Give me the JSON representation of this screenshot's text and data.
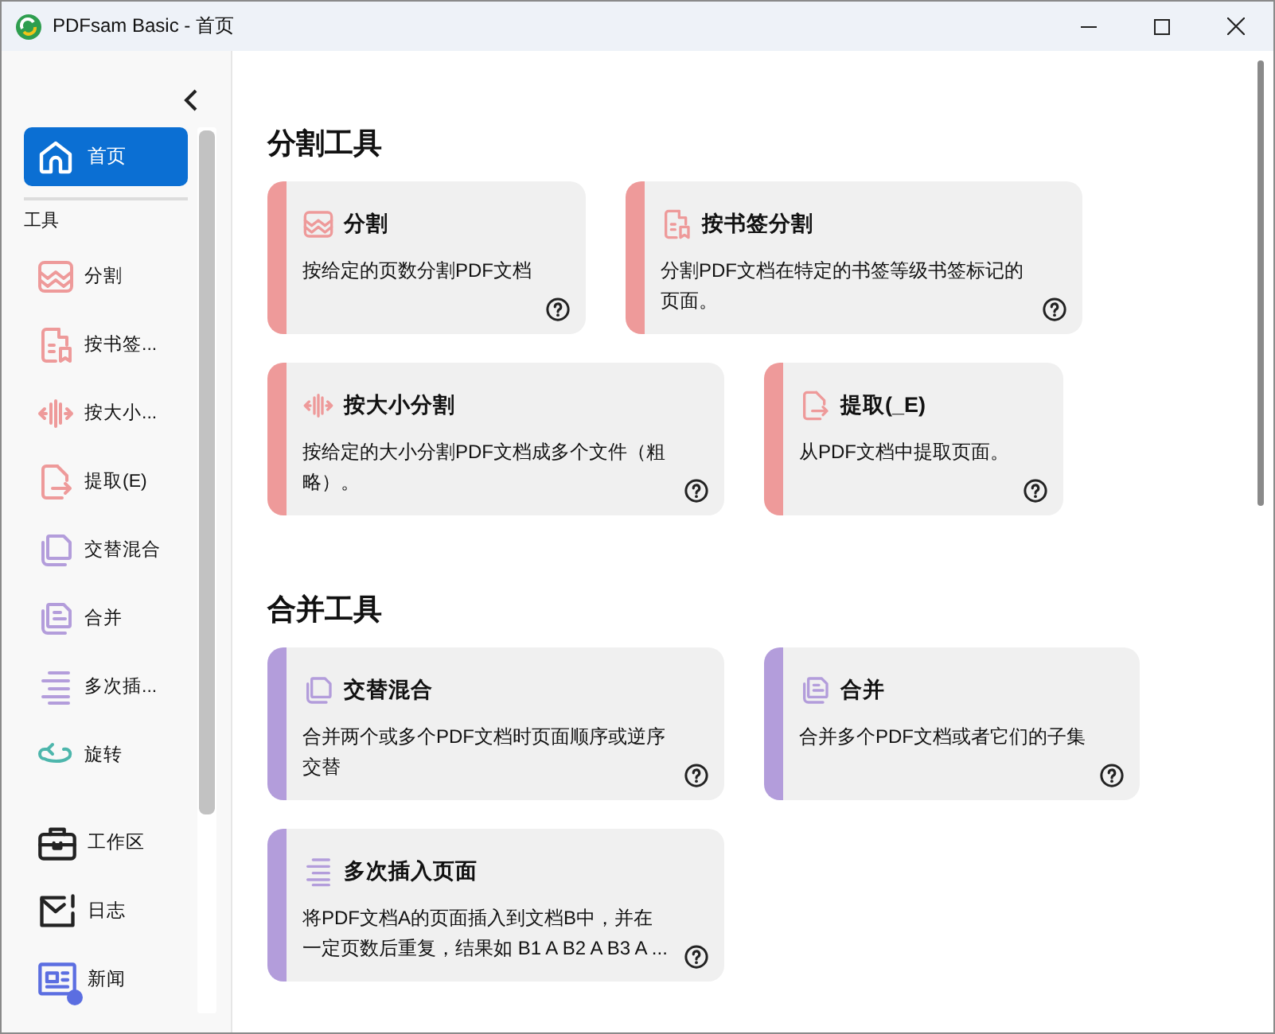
{
  "window": {
    "title": "PDFsam Basic - 首页"
  },
  "sidebar": {
    "home": {
      "label": "首页",
      "selected": true
    },
    "section": "工具",
    "tools": [
      {
        "kind": "split",
        "label": "分割",
        "color": "#ee9a9a"
      },
      {
        "kind": "bookmark",
        "label": "按书签...",
        "color": "#ee9a9a"
      },
      {
        "kind": "size",
        "label": "按大小...",
        "color": "#ee9a9a"
      },
      {
        "kind": "extract",
        "label": "提取(E)",
        "color": "#ee9a9a"
      },
      {
        "kind": "alternate",
        "label": "交替混合",
        "color": "#b39ddb"
      },
      {
        "kind": "merge",
        "label": "合并",
        "color": "#b39ddb"
      },
      {
        "kind": "insert",
        "label": "多次插...",
        "color": "#b39ddb"
      },
      {
        "kind": "rotate",
        "label": "旋转",
        "color": "#4db6ac"
      }
    ],
    "bottom": [
      {
        "kind": "workspace",
        "label": "工作区",
        "notification": false
      },
      {
        "kind": "log",
        "label": "日志",
        "notification": false
      },
      {
        "kind": "news",
        "label": "新闻",
        "notification": true
      }
    ]
  },
  "groups": [
    {
      "title": "分割工具",
      "color": "#ee9a9a",
      "cards": [
        {
          "kind": "split",
          "title": "分割",
          "description": "按给定的页数分割PDF文档"
        },
        {
          "kind": "bookmark",
          "title": "按书签分割",
          "description": "分割PDF文档在特定的书签等级书签标记的页面。"
        },
        {
          "kind": "size",
          "title": "按大小分割",
          "description": "按给定的大小分割PDF文档成多个文件（粗略）。"
        },
        {
          "kind": "extract",
          "title": "提取(_E)",
          "description": "从PDF文档中提取页面。"
        }
      ]
    },
    {
      "title": "合并工具",
      "color": "#b39ddb",
      "cards": [
        {
          "kind": "alternate",
          "title": "交替混合",
          "description": "合并两个或多个PDF文档时页面顺序或逆序交替"
        },
        {
          "kind": "merge",
          "title": "合并",
          "description": "合并多个PDF文档或者它们的子集"
        },
        {
          "kind": "insert",
          "title": "多次插入页面",
          "description": "将PDF文档A的页面插入到文档B中，并在一定页数后重复，结果如 B1 A B2 A B3 A ..."
        }
      ]
    }
  ]
}
